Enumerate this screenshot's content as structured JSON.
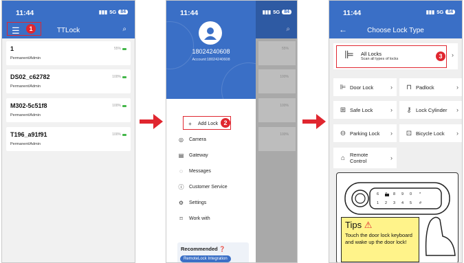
{
  "screen1": {
    "time": "11:44",
    "signal": "5G",
    "battery": "84",
    "title": "TTLock",
    "step": "1",
    "locks": [
      {
        "name": "1",
        "perm": "Permanent/Admin",
        "battery": "55%"
      },
      {
        "name": "DS02_c62782",
        "perm": "Permanent/Admin",
        "battery": "100%"
      },
      {
        "name": "M302-5c51f8",
        "perm": "Permanent/Admin",
        "battery": "100%"
      },
      {
        "name": "T196_a91f91",
        "perm": "Permanent/Admin",
        "battery": "100%"
      }
    ]
  },
  "screen2": {
    "time": "11:44",
    "signal": "5G",
    "battery": "84",
    "phone": "18024240608",
    "account": "Account:18024240608",
    "step": "2",
    "menu": [
      {
        "label": "Add Lock",
        "icon": "plus-icon"
      },
      {
        "label": "Camera",
        "icon": "camera-icon"
      },
      {
        "label": "Gateway",
        "icon": "gateway-icon"
      },
      {
        "label": "Messages",
        "icon": "message-icon"
      },
      {
        "label": "Customer Service",
        "icon": "info-icon"
      },
      {
        "label": "Settings",
        "icon": "gear-icon"
      },
      {
        "label": "Work with",
        "icon": "bookmark-icon"
      }
    ],
    "recommended": "Recommended",
    "recommended_btn": "RemoteLock Integration",
    "bg_pcts": [
      "55%",
      "100%",
      "100%",
      "100%"
    ]
  },
  "screen3": {
    "time": "11:44",
    "signal": "5G",
    "battery": "84",
    "title": "Choose Lock Type",
    "step": "3",
    "all_locks": "All Locks",
    "all_locks_sub": "Scan all types of locks",
    "types": [
      "Door Lock",
      "Padlock",
      "Safe Lock",
      "Lock Cylinder",
      "Parking Lock",
      "Bicycle Lock",
      "Remote Control"
    ],
    "tips_title": "Tips",
    "tips_text": "Touch the door lock keyboard and wake up the door lock!",
    "keypad": [
      "1",
      "2",
      "3",
      "4",
      "5",
      "6",
      "7",
      "8",
      "9",
      "0",
      "*",
      "#"
    ]
  }
}
